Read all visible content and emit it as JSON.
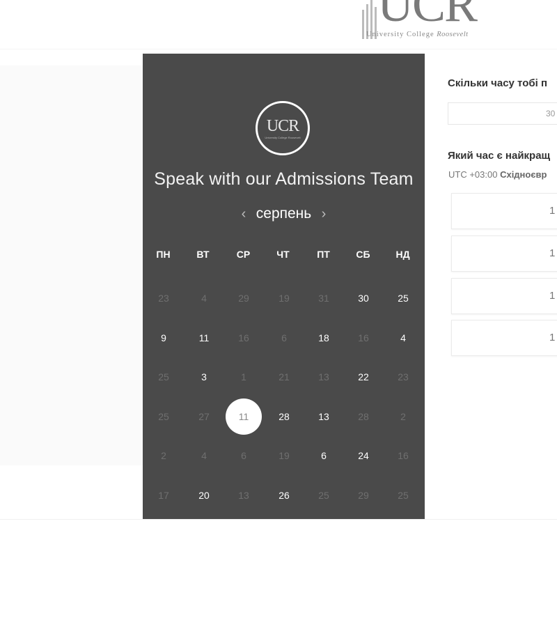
{
  "header": {
    "logo_text": "UCR",
    "logo_subtitle": "University College",
    "logo_subtitle_italic": "Roosevelt"
  },
  "calendar": {
    "logo_text": "UCR",
    "logo_subtext": "University College Roosevelt",
    "title": "Speak with our Admissions Team",
    "month": "серпень",
    "prev_icon": "‹",
    "next_icon": "›",
    "weekdays": [
      "ПН",
      "ВТ",
      "СР",
      "ЧТ",
      "ПТ",
      "СБ",
      "НД"
    ],
    "weeks": [
      [
        {
          "d": "23",
          "s": "dim"
        },
        {
          "d": "4",
          "s": "dim"
        },
        {
          "d": "29",
          "s": "dim"
        },
        {
          "d": "19",
          "s": "dim"
        },
        {
          "d": "31",
          "s": "dim"
        },
        {
          "d": "30",
          "s": "avail"
        },
        {
          "d": "25",
          "s": "avail"
        }
      ],
      [
        {
          "d": "9",
          "s": "avail"
        },
        {
          "d": "11",
          "s": "avail"
        },
        {
          "d": "16",
          "s": "dim"
        },
        {
          "d": "6",
          "s": "dim"
        },
        {
          "d": "18",
          "s": "avail"
        },
        {
          "d": "16",
          "s": "dim"
        },
        {
          "d": "4",
          "s": "avail"
        }
      ],
      [
        {
          "d": "25",
          "s": "dim"
        },
        {
          "d": "3",
          "s": "avail"
        },
        {
          "d": "1",
          "s": "dim"
        },
        {
          "d": "21",
          "s": "dim"
        },
        {
          "d": "13",
          "s": "dim"
        },
        {
          "d": "22",
          "s": "avail"
        },
        {
          "d": "23",
          "s": "dim"
        }
      ],
      [
        {
          "d": "25",
          "s": "dim"
        },
        {
          "d": "27",
          "s": "dim"
        },
        {
          "d": "11",
          "s": "sel"
        },
        {
          "d": "28",
          "s": "avail"
        },
        {
          "d": "13",
          "s": "avail"
        },
        {
          "d": "28",
          "s": "dim"
        },
        {
          "d": "2",
          "s": "dim"
        }
      ],
      [
        {
          "d": "2",
          "s": "dim"
        },
        {
          "d": "4",
          "s": "dim"
        },
        {
          "d": "6",
          "s": "dim"
        },
        {
          "d": "19",
          "s": "dim"
        },
        {
          "d": "6",
          "s": "avail"
        },
        {
          "d": "24",
          "s": "avail"
        },
        {
          "d": "16",
          "s": "dim"
        }
      ],
      [
        {
          "d": "17",
          "s": "dim"
        },
        {
          "d": "20",
          "s": "avail"
        },
        {
          "d": "13",
          "s": "dim"
        },
        {
          "d": "26",
          "s": "avail"
        },
        {
          "d": "25",
          "s": "dim"
        },
        {
          "d": "29",
          "s": "dim"
        },
        {
          "d": "25",
          "s": "dim"
        }
      ]
    ]
  },
  "booking": {
    "duration_question": "Скільки часу тобі п",
    "duration_value": "30",
    "time_question": "Який час є найкращ",
    "timezone_offset": "UTC +03:00",
    "timezone_name": "Східноєвр",
    "slots": [
      "1",
      "1",
      "1",
      "1"
    ]
  },
  "colors": {
    "calendar_bg": "#4a4a4a",
    "selected_day_bg": "#ffffff"
  }
}
